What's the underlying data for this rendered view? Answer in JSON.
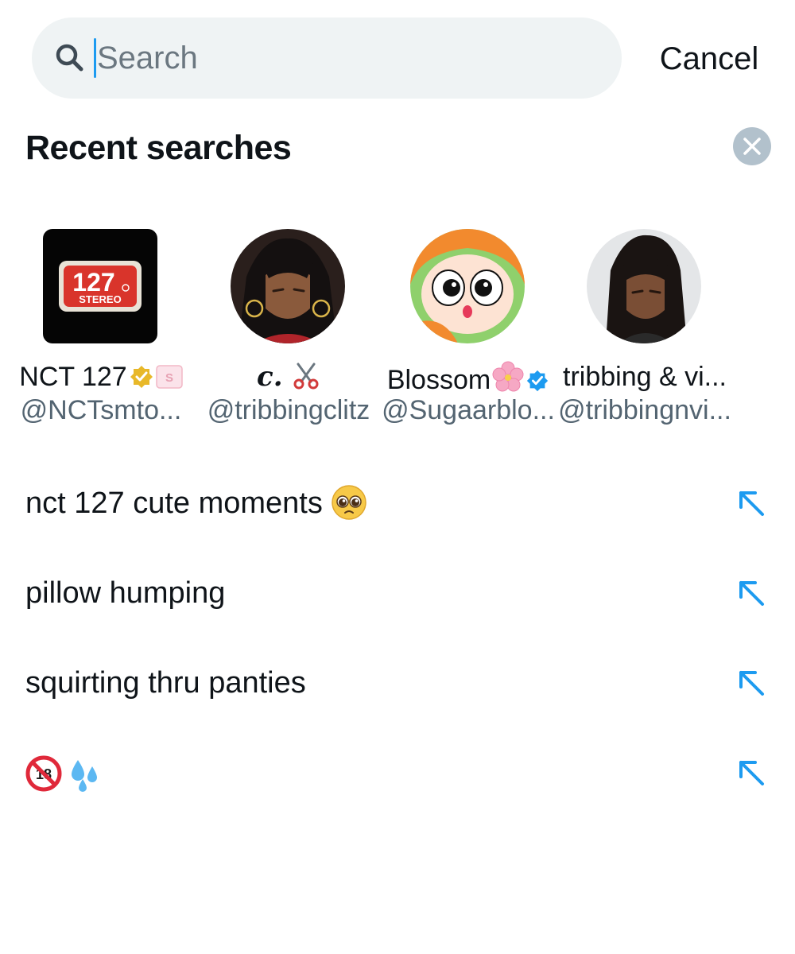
{
  "search": {
    "placeholder": "Search",
    "cancel_label": "Cancel"
  },
  "recent_searches": {
    "title": "Recent searches",
    "accounts": [
      {
        "name": "NCT 127",
        "handle": "@NCTsmto...",
        "badge": "gold-verified-badge",
        "avatar": "127-stereo-logo",
        "extra": "sm-label-icon"
      },
      {
        "name": "c.",
        "handle": "@tribbingclitz",
        "badge": null,
        "avatar": "anime-woman-avatar",
        "extra": "scissors-emoji"
      },
      {
        "name": "Blossom",
        "handle": "@Sugaarblo...",
        "badge": "blue-verified-badge",
        "avatar": "blossom-powerpuff-avatar",
        "extra": "cherry-blossom-emoji"
      },
      {
        "name": "tribbing & vi...",
        "handle": "@tribbingnvi...",
        "badge": null,
        "avatar": "anime-woman-avatar-2",
        "extra": null
      }
    ],
    "queries": [
      {
        "text": "nct 127 cute moments",
        "emoji": "pleading-face-emoji"
      },
      {
        "text": "pillow humping",
        "emoji": null
      },
      {
        "text": "squirting thru panties",
        "emoji": null
      },
      {
        "text": "",
        "emoji": "no-under-18-emoji sweat-droplets-emoji"
      }
    ]
  },
  "logo_text": {
    "number": "127",
    "word": "STEREO",
    "mark": "S"
  },
  "colors": {
    "accent": "#1d9bf0",
    "text": "#0f1419",
    "secondary": "#536471",
    "search_bg": "#eff3f4",
    "clear_bg": "#b2c1cc",
    "verified_gold": "#e8b829"
  }
}
